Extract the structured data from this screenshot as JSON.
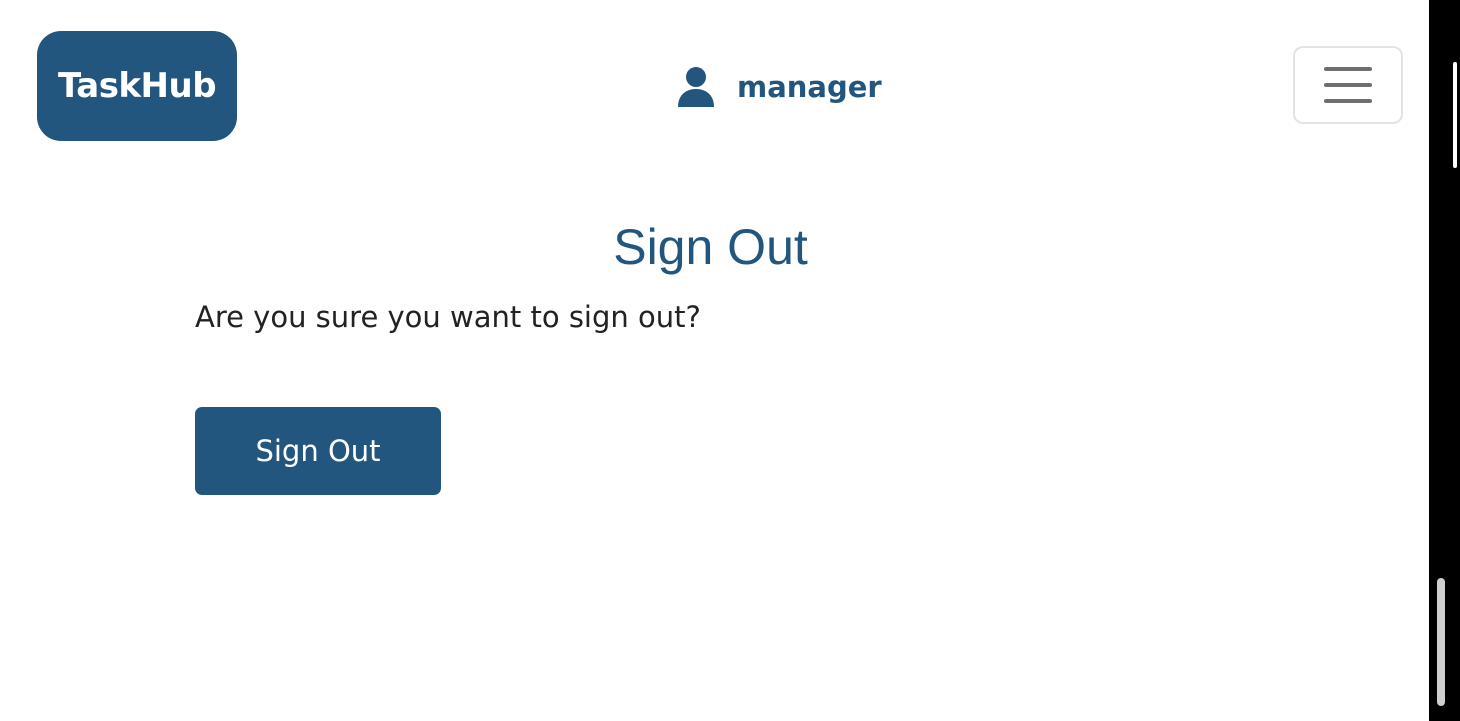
{
  "header": {
    "logo_text": "TaskHub",
    "user_name": "manager",
    "user_icon": "user-icon",
    "menu_icon": "hamburger-menu-icon"
  },
  "main": {
    "title": "Sign Out",
    "question": "Are you sure you want to sign out?",
    "signout_button_label": "Sign Out"
  },
  "colors": {
    "brand": "#23567e",
    "text": "#222222",
    "background": "#ffffff"
  }
}
